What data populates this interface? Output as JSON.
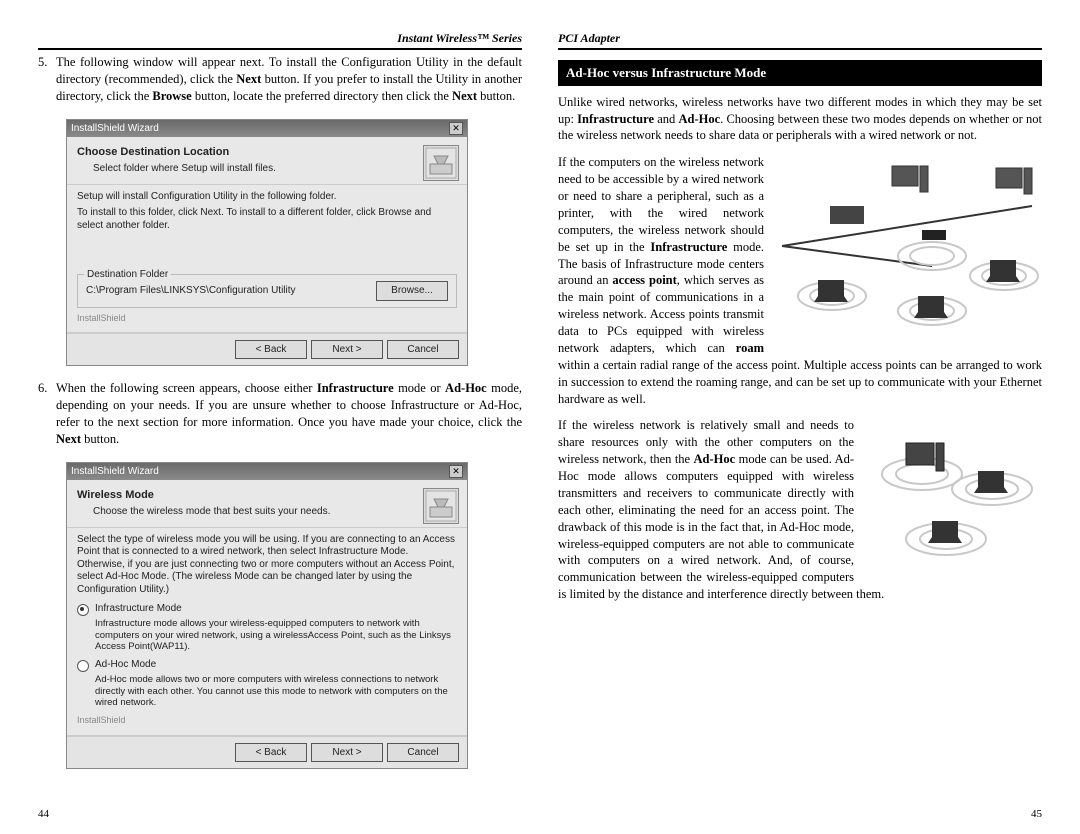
{
  "left": {
    "header": "Instant Wireless™ Series",
    "step5": {
      "num": "5.",
      "text_a": "The following window will appear next.  To install the Configuration Utility in the default directory (recommended), click the ",
      "next1": "Next",
      "text_b": " button.    If you prefer to install the Utility in another directory, click the ",
      "browse": "Browse",
      "text_c": " button, locate the preferred directory then click the ",
      "next2": "Next",
      "text_d": " button."
    },
    "dlg1": {
      "title": "InstallShield Wizard",
      "hd": "Choose Destination Location",
      "sub": "Select folder where Setup will install files.",
      "l1": "Setup will install Configuration Utility in the following folder.",
      "l2": "To install to this folder, click Next. To install to a different folder, click Browse and select another folder.",
      "group": "Destination Folder",
      "path": "C:\\Program Files\\LINKSYS\\Configuration Utility",
      "browse": "Browse...",
      "brand": "InstallShield",
      "back": "< Back",
      "next": "Next >",
      "cancel": "Cancel"
    },
    "step6": {
      "num": "6.",
      "text_a": "When the following screen appears, choose either ",
      "infra": "Infrastructure",
      "text_b": " mode or ",
      "adhoc": "Ad-Hoc",
      "text_c": " mode, depending on your needs.  If you are unsure whether to choose Infrastructure or Ad-Hoc, refer to the next section for more information.  Once you have made your choice, click the ",
      "next": "Next",
      "text_d": " button."
    },
    "dlg2": {
      "title": "InstallShield Wizard",
      "hd": "Wireless Mode",
      "sub": "Choose the wireless mode that best suits your needs.",
      "l1": "Select the type of wireless mode you will be using. If you are connecting to an Access Point that is connected to a wired network, then select Infrastructure Mode. Otherwise, if you are just connecting two or more computers without an Access Point, select Ad-Hoc Mode. (The wireless Mode can be changed later by using the Configuration Utility.)",
      "r1": "Infrastructure Mode",
      "r1d": "Infrastructure mode allows your wireless-equipped computers to network with computers on your wired network, using a wirelessAccess Point, such as the Linksys Access Point(WAP11).",
      "r2": "Ad-Hoc Mode",
      "r2d": "Ad-Hoc mode allows two or more computers with wireless connections to network directly with each other. You cannot use this mode to network with computers on the wired network.",
      "brand": "InstallShield",
      "back": "< Back",
      "next": "Next >",
      "cancel": "Cancel"
    },
    "page": "44"
  },
  "right": {
    "header": "PCI Adapter",
    "bar": "Ad-Hoc versus Infrastructure Mode",
    "p1a": "Unlike wired networks, wireless networks have two different modes in which they may be set up: ",
    "p1b": "Infrastructure",
    "p1c": " and ",
    "p1d": "Ad-Hoc",
    "p1e": ".  Choosing between these two modes depends on whether or not the wireless network needs to share data or peripherals with a wired network or not.",
    "p2a": "If the computers on the wireless network need to be accessible by a wired network or need to share a peripheral, such as a printer, with the wired network computers, the wireless network should be set up in the ",
    "p2b": "Infrastructure",
    "p2c": " mode. The basis of Infrastructure mode centers around an ",
    "p2d": "access point",
    "p2e": ", which serves as the main point of communications in a wireless network.  Access points transmit data to PCs equipped with wireless network adapters, which can ",
    "p2f": "roam",
    "p2g": " within a certain radial range of the access point. Multiple access points can be arranged to work in succession to extend the roaming range, and can be set up to communicate with your Ethernet hardware as well.",
    "p3a": "If the wireless network is relatively small and needs to share resources only with the other computers on the wireless network, then the ",
    "p3b": "Ad-Hoc",
    "p3c": " mode can be used.  Ad-Hoc mode allows computers equipped with wireless transmitters and receivers to communicate directly with each other, eliminating the need for an access point. The drawback of this mode is in the fact that, in Ad-Hoc mode, wireless-equipped computers are not able to communicate with computers on a wired network. And, of course, communication between the wireless-equipped computers is limited by the distance and interference directly between them.",
    "page": "45"
  }
}
